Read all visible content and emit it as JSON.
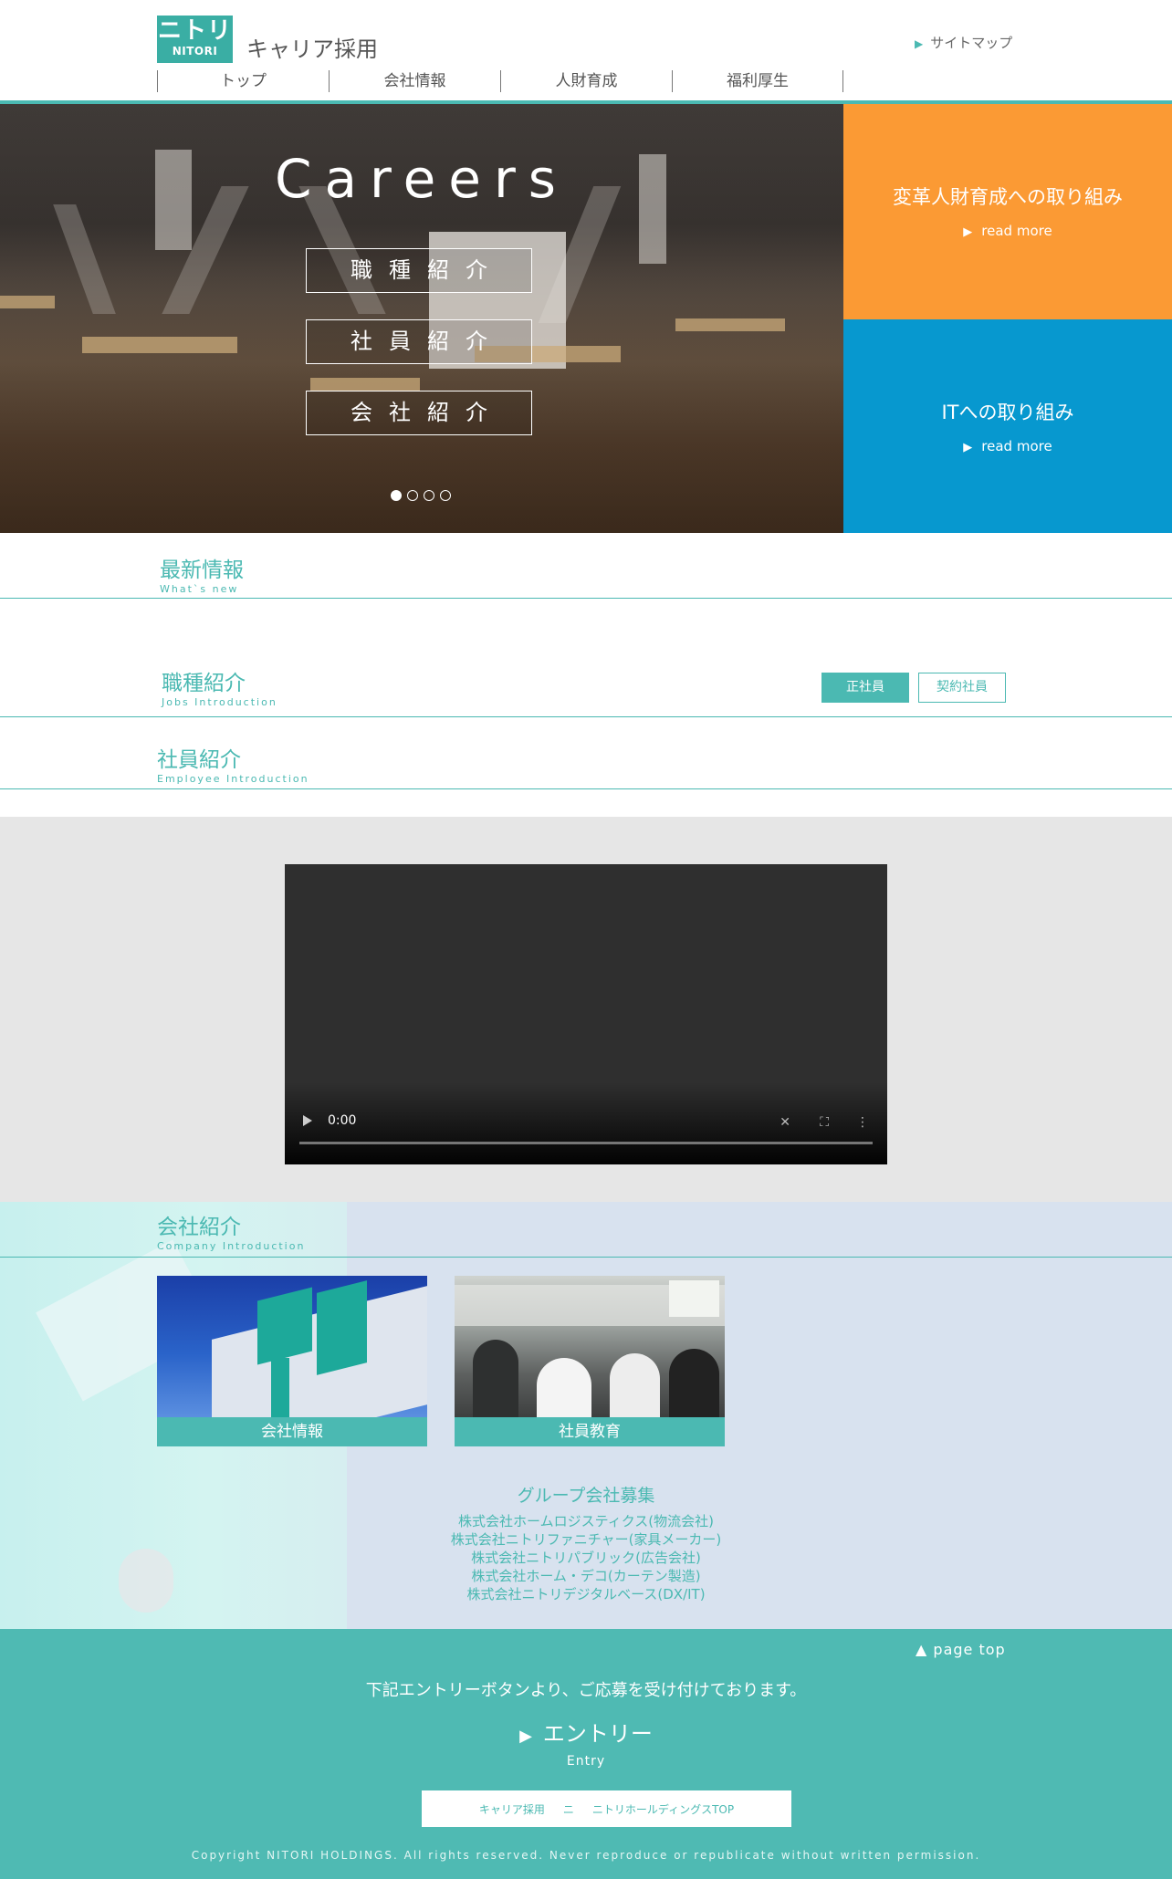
{
  "header": {
    "logo_jp": "ニトリ",
    "logo_en": "NITORI",
    "title": "キャリア採用",
    "sitemap": "サイトマップ",
    "nav": [
      "トップ",
      "会社情報",
      "人財育成",
      "福利厚生"
    ]
  },
  "hero": {
    "heading": "Careers",
    "buttons": [
      "職種紹介",
      "社員紹介",
      "会社紹介"
    ],
    "slide_count": 4,
    "active_slide": 1
  },
  "promos": [
    {
      "title": "変革人財育成への取り組み",
      "link": "read more",
      "color": "#fb9a34"
    },
    {
      "title": "ITへの取り組み",
      "link": "read more",
      "color": "#0798cf"
    }
  ],
  "news": {
    "title": "最新情報",
    "subtitle": "What`s new"
  },
  "jobs": {
    "title": "職種紹介",
    "subtitle": "Jobs Introduction",
    "tabs": [
      "正社員",
      "契約社員"
    ]
  },
  "employees": {
    "title": "社員紹介",
    "subtitle": "Employee Introduction"
  },
  "video": {
    "time": "0:00"
  },
  "company": {
    "title": "会社紹介",
    "subtitle": "Company Introduction",
    "cards": [
      "会社情報",
      "社員教育"
    ],
    "group_title": "グループ会社募集",
    "group_list": [
      "株式会社ホームロジスティクス(物流会社)",
      "株式会社ニトリファニチャー(家具メーカー)",
      "株式会社ニトリパブリック(広告会社)",
      "株式会社ホーム・デコ(カーテン製造)",
      "株式会社ニトリデジタルベース(DX/IT)"
    ]
  },
  "footer": {
    "page_top": "page top",
    "notice": "下記エントリーボタンより、ご応募を受け付けております。",
    "entry": "エントリー",
    "entry_sub": "Entry",
    "links": [
      "キャリア採用",
      "ニ",
      "ニトリホールディングスTOP"
    ],
    "copyright": "Copyright NITORI HOLDINGS. All rights reserved. Never reproduce or republicate without written permission."
  },
  "colors": {
    "accent": "#4bb9b2",
    "orange": "#fb9a34",
    "blue": "#0798cf"
  }
}
